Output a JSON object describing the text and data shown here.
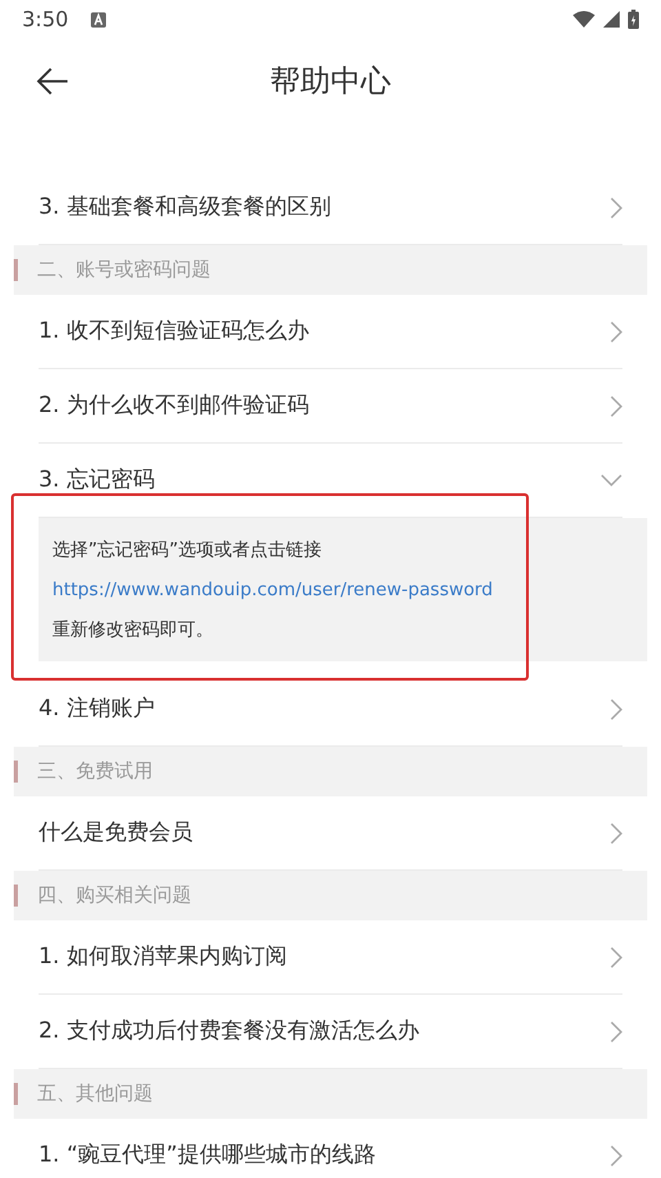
{
  "status_bar": {
    "time": "3:50"
  },
  "header": {
    "title": "帮助中心"
  },
  "sections": [
    {
      "items": [
        {
          "label": "3. 基础套餐和高级套餐的区别",
          "expanded": false
        }
      ]
    },
    {
      "title": "二、账号或密码问题",
      "items": [
        {
          "label": "1. 收不到短信验证码怎么办",
          "expanded": false
        },
        {
          "label": "2. 为什么收不到邮件验证码",
          "expanded": false
        },
        {
          "label": "3. 忘记密码",
          "expanded": true,
          "highlighted": true,
          "answer": [
            {
              "kind": "text",
              "text": "选择”忘记密码”选项或者点击链接"
            },
            {
              "kind": "link",
              "text": "https://www.wandouip.com/user/renew-password"
            },
            {
              "kind": "text",
              "text": "重新修改密码即可。"
            }
          ]
        },
        {
          "label": "4. 注销账户",
          "expanded": false
        }
      ]
    },
    {
      "title": "三、免费试用",
      "items": [
        {
          "label": "什么是免费会员",
          "expanded": false
        }
      ]
    },
    {
      "title": "四、购买相关问题",
      "items": [
        {
          "label": "1. 如何取消苹果内购订阅",
          "expanded": false
        },
        {
          "label": "2. 支付成功后付费套餐没有激活怎么办",
          "expanded": false
        }
      ]
    },
    {
      "title": "五、其他问题",
      "items": [
        {
          "label": "1. “豌豆代理”提供哪些城市的线路",
          "expanded": false
        }
      ]
    }
  ]
}
